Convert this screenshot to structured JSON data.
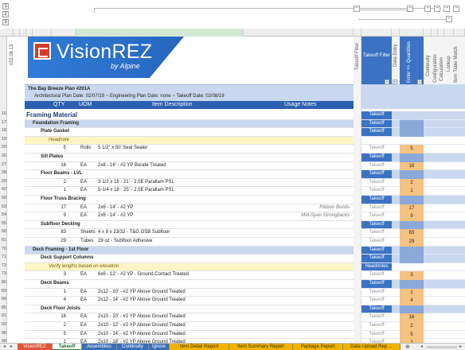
{
  "sheet_ids": {
    "left_vertical": "v22.06.13"
  },
  "logo": {
    "brand": "VisionREZ",
    "sub": "by Alpine"
  },
  "right_headers": {
    "takeoff_filter": "Takeoff Filter",
    "data_entry": "Data Entry",
    "enter_quantities": "Enter +/- Quantities",
    "continuity": "Continuity",
    "configuration": "Configuration",
    "calculation": "Calculation",
    "lookup": "Lookup",
    "item_table_match": "Item Table Match"
  },
  "col_headers": [
    "A",
    "B",
    "C",
    "D",
    "E",
    "F",
    "G",
    "H",
    "I",
    "J",
    "K",
    "L",
    "M",
    "P",
    "W",
    "AH",
    "D"
  ],
  "header_rows": {
    "r2": "The Bay Breeze Plan #201A",
    "r3": "Architectural Plan Date: 02/07/19 ~ Engineering Plan Date: none ~ Takeoff Date: 02/08/19",
    "r4": {
      "qty": "QTY",
      "uom": "UOM",
      "desc": "Item Description",
      "notes": "Usage Notes"
    }
  },
  "takeoff_filter_label": "Takeoff Filter",
  "rows": [
    {
      "n": "16",
      "type": "section",
      "text": "Framing Material",
      "tk": "Takeoff"
    },
    {
      "n": "17",
      "type": "group",
      "text": "Foundation Framing",
      "tk": "Takeoff"
    },
    {
      "n": "18",
      "type": "sub",
      "text": "Plate Gasket",
      "tk": "Takeoff"
    },
    {
      "n": "19",
      "type": "note",
      "text": "Headnote",
      "tk": ""
    },
    {
      "n": "20",
      "type": "item",
      "qty": "5",
      "uom": "Rolls",
      "desc": "5 1/2\" x 50' Seal Sealer",
      "notes": "",
      "tk": "Takeoff",
      "q": "5"
    },
    {
      "n": "26",
      "type": "sub",
      "text": "Sill Plates",
      "tk": "Takeoff"
    },
    {
      "n": "27",
      "type": "item",
      "qty": "16",
      "uom": "EA",
      "desc": "2x8 - 16' - #2 YP Borate Treated",
      "notes": "",
      "tk": "Takeoff",
      "q": "16"
    },
    {
      "n": "28",
      "type": "sub",
      "text": "Floor Beams - LVL",
      "tk": "Takeoff"
    },
    {
      "n": "29",
      "type": "item",
      "qty": "2",
      "uom": "EA",
      "desc": "3-1/2 x 16 - 21' - 2.0E Parallam PSL",
      "notes": "",
      "tk": "Takeoff",
      "q": "2"
    },
    {
      "n": "42",
      "type": "item",
      "qty": "1",
      "uom": "EA",
      "desc": "5-1/4 x 18 - 25' - 2.0E Parallam PSL",
      "notes": "",
      "tk": "Takeoff",
      "q": "1"
    },
    {
      "n": "50",
      "type": "sub",
      "text": "Floor Truss Bracing",
      "tk": "Takeoff"
    },
    {
      "n": "53",
      "type": "item",
      "qty": "17",
      "uom": "EA",
      "desc": "2x6 - 14' - #2 YP",
      "notes": "Ribbon Bonds",
      "tk": "Takeoff",
      "q": "17"
    },
    {
      "n": "54",
      "type": "item",
      "qty": "9",
      "uom": "EA",
      "desc": "2x6 - 14' - #2 YP",
      "notes": "Mid-Span Strongbacks",
      "tk": "Takeoff",
      "q": "9"
    },
    {
      "n": "55",
      "type": "sub",
      "text": "Subfloor Decking",
      "tk": "Takeoff"
    },
    {
      "n": "58",
      "type": "item",
      "qty": "83",
      "uom": "Sheets",
      "desc": "4 x 8 x 23/32 - T&G OSB Subfloor",
      "notes": "",
      "tk": "Takeoff",
      "q": "83"
    },
    {
      "n": "61",
      "type": "item",
      "qty": "29",
      "uom": "Tubes",
      "desc": "29 oz - Subfloor Adhesive",
      "notes": "",
      "tk": "Takeoff",
      "q": "29"
    },
    {
      "n": "70",
      "type": "group",
      "text": "Deck Framing - 1st Floor",
      "tk": "Takeoff"
    },
    {
      "n": "71",
      "type": "sub",
      "text": "Deck Support Columns",
      "tk": "Takeoff"
    },
    {
      "n": "72",
      "type": "note",
      "text": "Verify lengths based on elevation",
      "tk": "Headnotes"
    },
    {
      "n": "73",
      "type": "item",
      "qty": "3",
      "uom": "EA",
      "desc": "6x6 - 12' - #2 YP - Ground Contact Treated",
      "notes": "",
      "tk": "Takeoff",
      "q": "3"
    },
    {
      "n": "80",
      "type": "sub",
      "text": "Deck Beams",
      "tk": "Takeoff"
    },
    {
      "n": "83",
      "type": "item",
      "qty": "1",
      "uom": "EA",
      "desc": "2x12 - 10' - #2 YP Above Ground Treated",
      "notes": "",
      "tk": "Takeoff",
      "q": "1"
    },
    {
      "n": "84",
      "type": "item",
      "qty": "4",
      "uom": "EA",
      "desc": "2x12 - 14' - #2 YP Above Ground Treated",
      "notes": "",
      "tk": "Takeoff",
      "q": "4"
    },
    {
      "n": "85",
      "type": "sub",
      "text": "Deck Floor Joists",
      "tk": "Takeoff"
    },
    {
      "n": "91",
      "type": "item",
      "qty": "16",
      "uom": "EA",
      "desc": "2x10 - 10' - #2 YP Above Ground Treated",
      "notes": "",
      "tk": "Takeoff",
      "q": "16"
    },
    {
      "n": "92",
      "type": "item",
      "qty": "2",
      "uom": "EA",
      "desc": "2x10 - 12' - #2 YP Above Ground Treated",
      "notes": "",
      "tk": "Takeoff",
      "q": "2"
    },
    {
      "n": "95",
      "type": "item",
      "qty": "5",
      "uom": "EA",
      "desc": "2x10 - 14' - #2 YP Above Ground Treated",
      "notes": "",
      "tk": "Takeoff",
      "q": "5"
    },
    {
      "n": "98",
      "type": "item",
      "qty": "1",
      "uom": "EA",
      "desc": "2x10 - 18' - #2 YP Above Ground Treated",
      "notes": "",
      "tk": "Takeoff",
      "q": "1"
    },
    {
      "n": "102",
      "type": "sub",
      "text": "Deck Stair Stringers",
      "tk": ""
    }
  ],
  "tabs": [
    {
      "label": "VisionREZ",
      "color": "#e0553a"
    },
    {
      "label": "Takeoff",
      "color": "#2e8b3e",
      "active": true
    },
    {
      "label": "Assemblies",
      "color": "#3a6fb5"
    },
    {
      "label": "Continuity",
      "color": "#3a6fb5"
    },
    {
      "label": "Ignore",
      "color": "#3a6fb5"
    },
    {
      "label": "Item Detail Report",
      "color": "#f0b400"
    },
    {
      "label": "Item Summary Report",
      "color": "#f0b400"
    },
    {
      "label": "Package Report",
      "color": "#f0b400"
    },
    {
      "label": "Data Upload Rep ...",
      "color": "#f0b400"
    }
  ],
  "colors": {
    "blue_band": "#3c72c4",
    "light_blue": "#c9d8ee",
    "qty_orange": "#f5c27f",
    "note_yellow": "#fff6c4",
    "header_blue": "#2b5fb0"
  }
}
